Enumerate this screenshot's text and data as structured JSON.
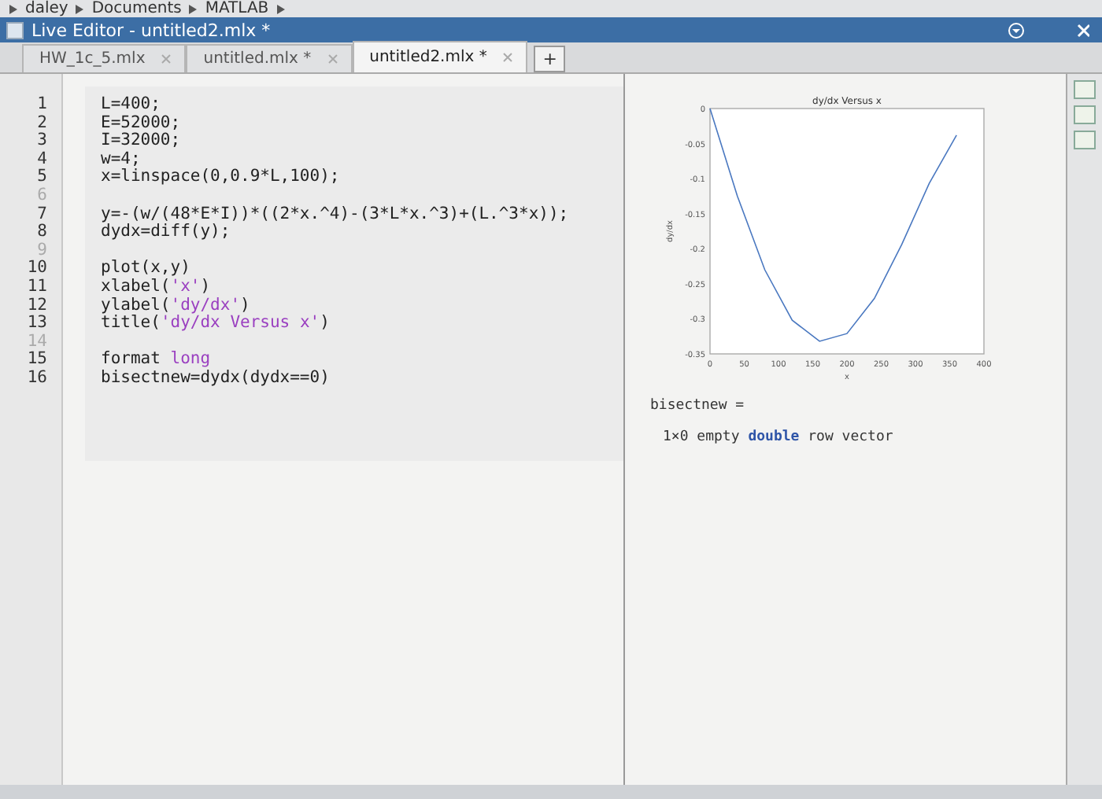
{
  "breadcrumb": [
    "daley",
    "Documents",
    "MATLAB"
  ],
  "window": {
    "title": "Live Editor - untitled2.mlx *"
  },
  "tabs": [
    {
      "label": "HW_1c_5.mlx",
      "selected": false
    },
    {
      "label": "untitled.mlx *",
      "selected": false
    },
    {
      "label": "untitled2.mlx *",
      "selected": true
    }
  ],
  "new_tab": "+",
  "code_lines": [
    {
      "number": "1",
      "segments": [
        {
          "text": "L=400;",
          "kind": "plain"
        }
      ]
    },
    {
      "number": "2",
      "segments": [
        {
          "text": "E=52000;",
          "kind": "plain"
        }
      ]
    },
    {
      "number": "3",
      "segments": [
        {
          "text": "I=32000;",
          "kind": "plain"
        }
      ]
    },
    {
      "number": "4",
      "segments": [
        {
          "text": "w=4;",
          "kind": "plain"
        }
      ]
    },
    {
      "number": "5",
      "segments": [
        {
          "text": "x=linspace(0,0.9*L,100);",
          "kind": "plain"
        }
      ]
    },
    {
      "number": "6"
    },
    {
      "number": "7",
      "segments": [
        {
          "text": "y=-(w/(48*E*I))*((2*x.^4)-(3*L*x.^3)+(L.^3*x));",
          "kind": "plain"
        }
      ]
    },
    {
      "number": "8",
      "segments": [
        {
          "text": "dydx=diff(y);",
          "kind": "plain"
        }
      ]
    },
    {
      "number": "9"
    },
    {
      "number": "10",
      "segments": [
        {
          "text": "plot(x,y)",
          "kind": "plain"
        }
      ]
    },
    {
      "number": "11",
      "segments": [
        {
          "text": "xlabel(",
          "kind": "plain"
        },
        {
          "text": "'x'",
          "kind": "string"
        },
        {
          "text": ")",
          "kind": "plain"
        }
      ]
    },
    {
      "number": "12",
      "segments": [
        {
          "text": "ylabel(",
          "kind": "plain"
        },
        {
          "text": "'dy/dx'",
          "kind": "string"
        },
        {
          "text": ")",
          "kind": "plain"
        }
      ]
    },
    {
      "number": "13",
      "segments": [
        {
          "text": "title(",
          "kind": "plain"
        },
        {
          "text": "'dy/dx Versus x'",
          "kind": "string"
        },
        {
          "text": ")",
          "kind": "plain"
        }
      ]
    },
    {
      "number": "14"
    },
    {
      "number": "15",
      "segments": [
        {
          "text": "format ",
          "kind": "plain"
        },
        {
          "text": "long",
          "kind": "string"
        }
      ]
    },
    {
      "number": "16",
      "segments": [
        {
          "text": "bisectnew=dydx(dydx==0)",
          "kind": "plain"
        }
      ]
    }
  ],
  "output": {
    "chart_data": {
      "type": "line",
      "title": "dy/dx Versus x",
      "xlabel": "x",
      "ylabel": "dy/dx",
      "x": [
        0,
        40,
        80,
        120,
        160,
        200,
        240,
        280,
        320,
        360
      ],
      "series": [
        {
          "color": "#4a78c0",
          "values": [
            0,
            -0.125,
            -0.23,
            -0.302,
            -0.332,
            -0.321,
            -0.271,
            -0.194,
            -0.107,
            -0.038
          ]
        }
      ],
      "xlim": [
        0,
        400
      ],
      "ylim": [
        -0.35,
        0
      ],
      "xticks": [
        0,
        50,
        100,
        150,
        200,
        250,
        300,
        350,
        400
      ],
      "yticks": [
        0,
        -0.05,
        -0.1,
        -0.15,
        -0.2,
        -0.25,
        -0.3,
        -0.35
      ]
    },
    "lines": [
      [
        {
          "text": "bisectnew =",
          "kind": "plain"
        }
      ],
      [
        {
          "text": "1×0 empty ",
          "kind": "plain"
        },
        {
          "text": "double",
          "kind": "keyword"
        },
        {
          "text": " row vector",
          "kind": "plain"
        }
      ]
    ]
  }
}
